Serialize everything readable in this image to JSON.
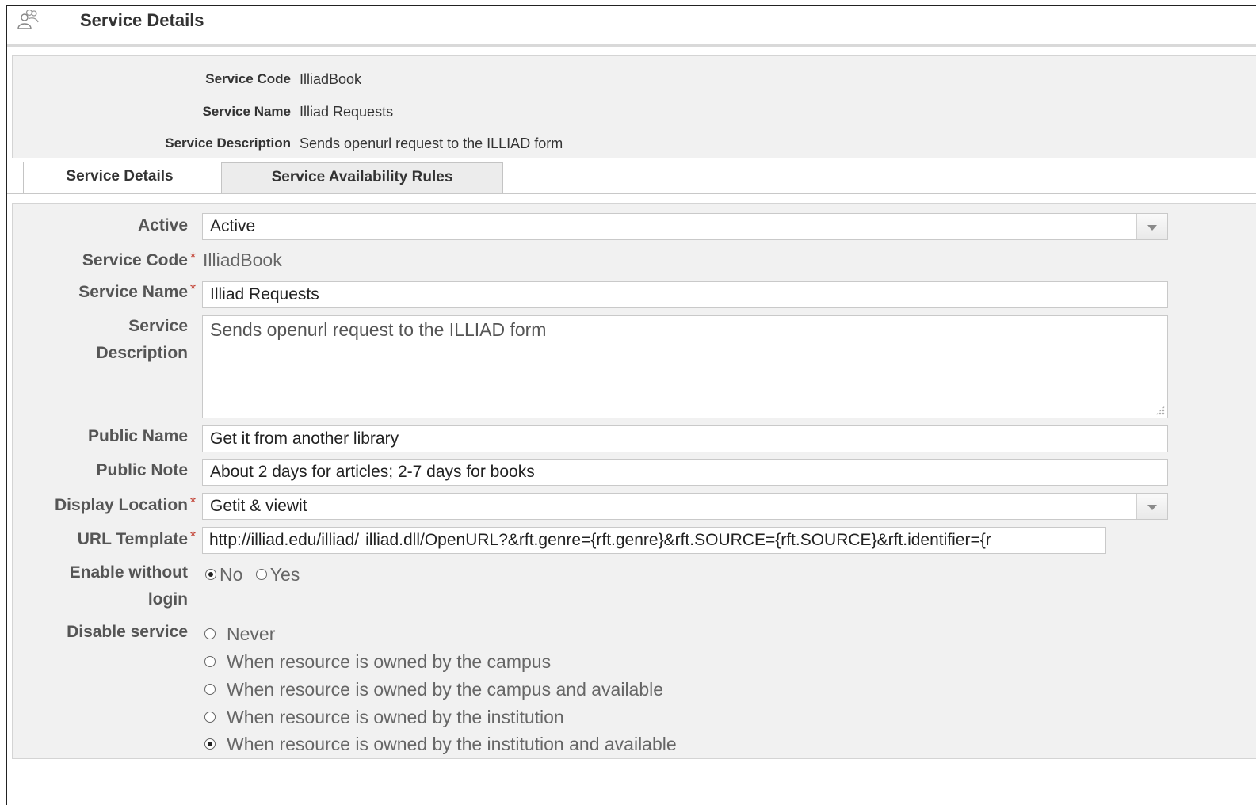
{
  "header": {
    "title": "Service Details",
    "icon": "users-icon"
  },
  "summary": {
    "rows": [
      {
        "label": "Service Code",
        "value": "IlliadBook"
      },
      {
        "label": "Service Name",
        "value": "Illiad Requests"
      },
      {
        "label": "Service Description",
        "value": "Sends openurl request to the ILLIAD form"
      }
    ]
  },
  "tabs": [
    {
      "label": "Service Details",
      "active": true
    },
    {
      "label": "Service Availability Rules",
      "active": false
    }
  ],
  "form": {
    "active": {
      "label": "Active",
      "value": "Active"
    },
    "service_code": {
      "label": "Service Code",
      "value": "IlliadBook"
    },
    "service_name": {
      "label": "Service Name",
      "value": "Illiad Requests"
    },
    "service_description": {
      "label_line1": "Service",
      "label_line2": "Description",
      "value": "Sends openurl request to the ILLIAD form"
    },
    "public_name": {
      "label": "Public Name",
      "value": "Get it from another library"
    },
    "public_note": {
      "label": "Public Note",
      "value": "About 2 days for articles; 2-7 days for books"
    },
    "display_location": {
      "label": "Display Location",
      "value": "Getit & viewit"
    },
    "url_template": {
      "label": "URL Template",
      "value": "http://illiad.edu/illiad/illiad.dll/OpenURL?&rft.genre={rft.genre}&rft.SOURCE={rft.SOURCE}&rft.identifier={r",
      "value_part1": "http://illiad.",
      "value_part2": "edu/illiad/",
      "value_part3": "illiad.dll/OpenURL?&rft.genre={rft.genre}&rft.SOURCE={rft.SOURCE}&rft.identifier={r"
    },
    "enable_without_login": {
      "label_line1": "Enable without",
      "label_line2": "login",
      "options": [
        {
          "label": "No",
          "checked": true
        },
        {
          "label": "Yes",
          "checked": false
        }
      ]
    },
    "disable_service": {
      "label": "Disable service",
      "options": [
        {
          "label": "Never",
          "checked": false
        },
        {
          "label": "When resource is owned by the campus",
          "checked": false
        },
        {
          "label": "When resource is owned by the campus and available",
          "checked": false
        },
        {
          "label": "When resource is owned by the institution",
          "checked": false
        },
        {
          "label": "When resource is owned by the institution and available",
          "checked": true
        }
      ]
    }
  },
  "colors": {
    "required": "#c0392b",
    "panel_bg": "#f1f1f1",
    "border": "#d4d4d4"
  }
}
